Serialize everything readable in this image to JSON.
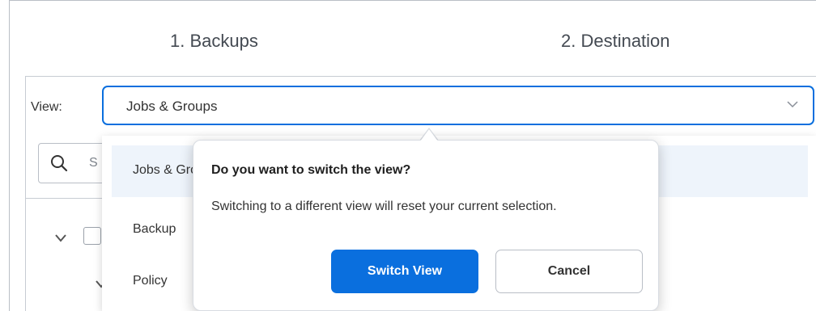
{
  "steps": [
    {
      "label": "1. Backups"
    },
    {
      "label": "2. Destination"
    }
  ],
  "view": {
    "label": "View:",
    "selected": "Jobs & Groups",
    "chevron_icon": "chevron-down-icon"
  },
  "search": {
    "placeholder_visible": "S",
    "icon": "search-icon"
  },
  "dropdown": {
    "items": [
      {
        "label": "Jobs & Groups",
        "visible": "Jobs & G"
      },
      {
        "label": "Backup"
      },
      {
        "label": "Policy"
      }
    ]
  },
  "dialog": {
    "title": "Do you want to switch the view?",
    "message": "Switching to a different view will reset your current selection.",
    "primary_label": "Switch View",
    "secondary_label": "Cancel"
  },
  "colors": {
    "accent": "#0a6fde",
    "selected_row": "#eef4fb",
    "border": "#b9bec6"
  }
}
